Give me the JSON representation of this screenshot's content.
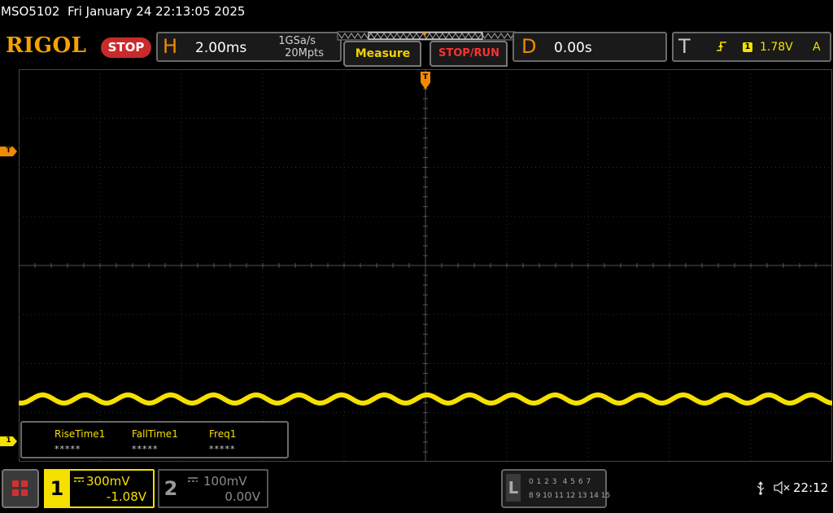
{
  "header": {
    "model": "MSO5102",
    "datetime": "Fri January 24 22:13:05 2025"
  },
  "logo": {
    "text": "RIGOL"
  },
  "run_status": {
    "label": "STOP"
  },
  "horizontal": {
    "letter": "H",
    "timebase": "2.00ms",
    "sample_rate": "1GSa/s",
    "memory_depth": "20Mpts"
  },
  "buttons": {
    "measure": "Measure",
    "stop_run": "STOP/RUN"
  },
  "delay": {
    "letter": "D",
    "value": "0.00s"
  },
  "trigger": {
    "letter": "T",
    "slope_icon": "rising-edge-icon",
    "source": "1",
    "level": "1.78V",
    "coupling": "A"
  },
  "markers": {
    "trigger_level": "T",
    "ch1": "1",
    "trigger_position": "T"
  },
  "measurements": [
    {
      "name": "RiseTime1",
      "value": "*****"
    },
    {
      "name": "FallTime1",
      "value": "*****"
    },
    {
      "name": "Freq1",
      "value": "*****"
    }
  ],
  "channels": [
    {
      "number": "1",
      "scale": "300mV",
      "offset": "-1.08V",
      "color": "#f5e000",
      "active": true
    },
    {
      "number": "2",
      "scale": "100mV",
      "offset": "0.00V",
      "color": "#8a8a8a",
      "active": false
    }
  ],
  "logic_analyzer": {
    "letter": "L",
    "row1": "0 1 2 3  4 5 6 7",
    "row2": "8 9 10 11 12 13 14 15"
  },
  "status_bar": {
    "usb_icon": "usb-icon",
    "sound_icon": "mute-icon",
    "time": "22:12"
  },
  "colors": {
    "ch1": "#f5e000",
    "accent": "#f08a00",
    "stop": "#c82b2b",
    "grid": "#3a3a3a"
  }
}
